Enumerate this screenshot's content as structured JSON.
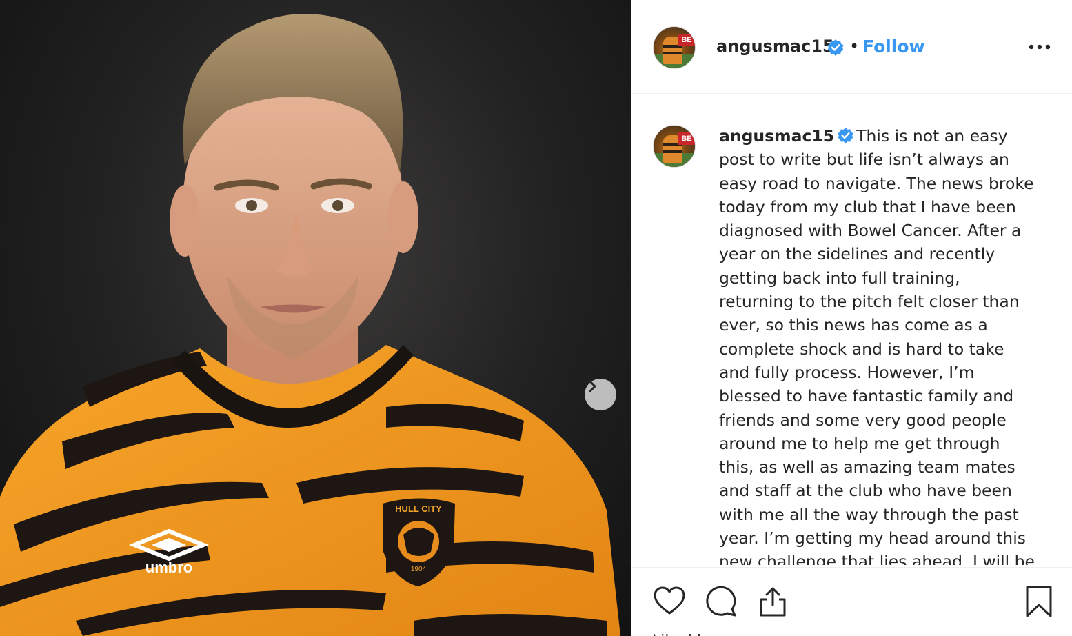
{
  "photo": {
    "description_alt": "",
    "jersey_brand": "umbro",
    "badge_text": "HULL CITY",
    "badge_year": "1904",
    "next_icon": "chevron-right-icon"
  },
  "header": {
    "username": "angusmac15",
    "verified_icon": "verified-badge-icon",
    "separator": "•",
    "follow_label": "Follow",
    "more_icon": "more-options-icon"
  },
  "caption": {
    "username": "angusmac15",
    "text": "This is not an easy post to write but life isn’t always an easy road to navigate. The news broke today from my club that I have been diagnosed with Bowel Cancer. After a year on the sidelines and recently getting back into full training, returning to the pitch felt closer than ever, so this news has come as a complete shock and is hard to take and fully process. However, I’m blessed to have fantastic family and friends and some very good people around me to help me get through this, as well as amazing team mates and staff at the club who have been with me all the way through the past year. I’m getting my head around this new challenge that lies ahead. I will be"
  },
  "actions": {
    "like_icon": "heart-icon",
    "comment_icon": "comment-icon",
    "share_icon": "share-icon",
    "save_icon": "bookmark-icon",
    "liked_by": "Liked by"
  },
  "colors": {
    "accent": "#3897f0",
    "jersey_orange": "#f39a1e",
    "jersey_stripe": "#1d1612"
  }
}
